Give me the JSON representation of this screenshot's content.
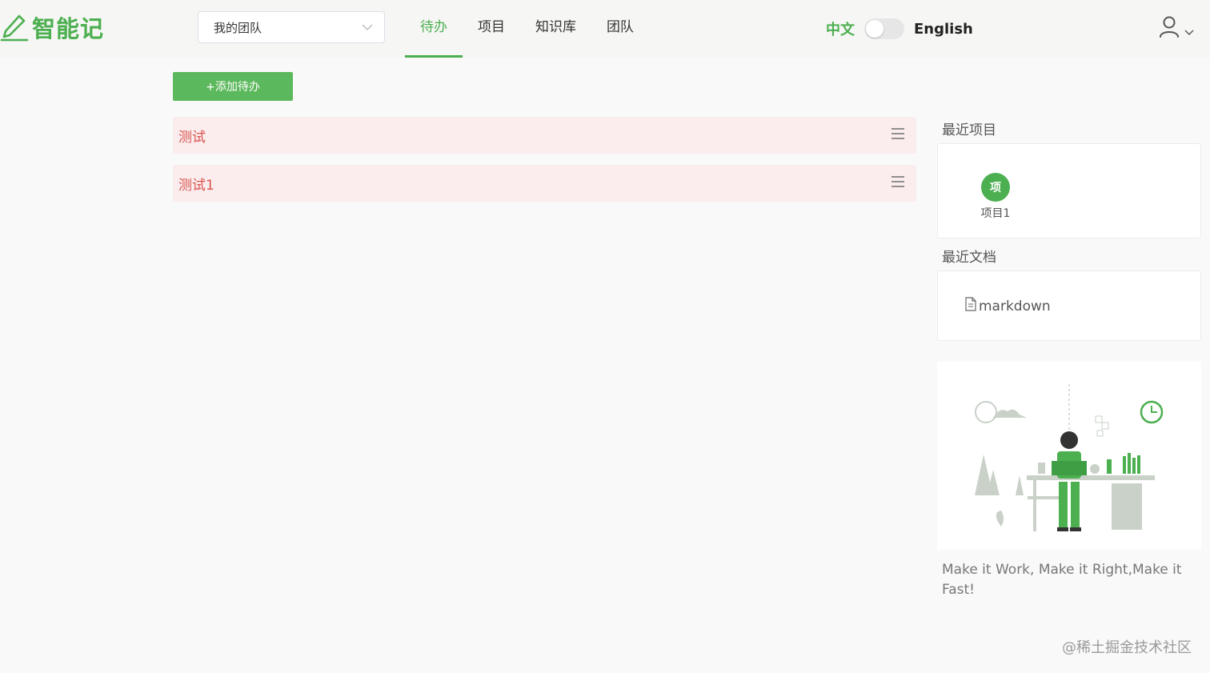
{
  "app": {
    "logo_text": "智能记"
  },
  "header": {
    "team_select": {
      "value": "我的团队"
    },
    "nav": [
      {
        "label": "待办",
        "active": true
      },
      {
        "label": "项目",
        "active": false
      },
      {
        "label": "知识库",
        "active": false
      },
      {
        "label": "团队",
        "active": false
      }
    ],
    "language": {
      "zh_label": "中文",
      "en_label": "English",
      "english_enabled": false
    }
  },
  "main": {
    "add_button_label": "+添加待办",
    "todos": [
      {
        "label": "测试"
      },
      {
        "label": "测试1"
      }
    ]
  },
  "sidebar": {
    "recent_projects_title": "最近项目",
    "recent_projects": [
      {
        "avatar_text": "项",
        "name": "项目1"
      }
    ],
    "recent_docs_title": "最近文档",
    "recent_docs": [
      {
        "name": "markdown"
      }
    ],
    "quote": "Make it Work, Make it Right,Make it Fast!"
  },
  "watermark": "@稀土掘金技术社区",
  "colors": {
    "accent": "#4caf50",
    "button": "#5cb85c",
    "todo_bg": "#fbeded",
    "todo_text": "#d9534f"
  }
}
